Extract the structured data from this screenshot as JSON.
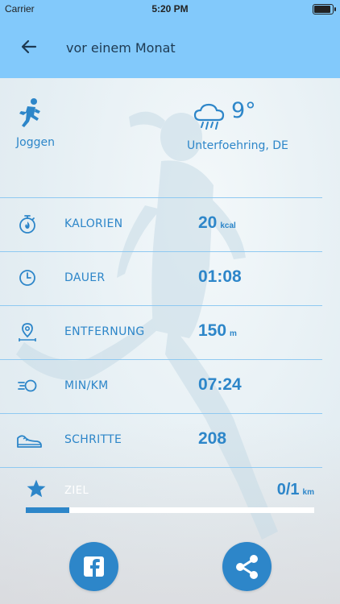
{
  "status_bar": {
    "carrier": "Carrier",
    "time": "5:20 PM"
  },
  "header": {
    "title": "vor einem Monat",
    "back_icon": "arrow-left-icon"
  },
  "activity": {
    "type_label": "Joggen",
    "icon": "running-icon"
  },
  "weather": {
    "temperature": "9°",
    "location": "Unterfoehring, DE",
    "icon": "rain-cloud-icon"
  },
  "stats": [
    {
      "label": "KALORIEN",
      "value": "20",
      "unit": "kcal",
      "icon": "stopwatch-flame-icon"
    },
    {
      "label": "DAUER",
      "value": "01:08",
      "unit": "",
      "icon": "clock-icon"
    },
    {
      "label": "ENTFERNUNG",
      "value": "150",
      "unit": "m",
      "icon": "location-pin-icon"
    },
    {
      "label": "MIN/KM",
      "value": "07:24",
      "unit": "",
      "icon": "speed-icon"
    },
    {
      "label": "SCHRITTE",
      "value": "208",
      "unit": "",
      "icon": "sneaker-icon"
    }
  ],
  "goal": {
    "label": "ZIEL",
    "value": "0/1",
    "unit": "km",
    "progress": 0.15,
    "icon": "star-icon"
  },
  "actions": {
    "facebook_icon": "facebook-icon",
    "share_icon": "share-icon"
  },
  "colors": {
    "accent": "#2d86c9",
    "header_bg": "#82c9fb",
    "divider": "#8fc9f1"
  }
}
